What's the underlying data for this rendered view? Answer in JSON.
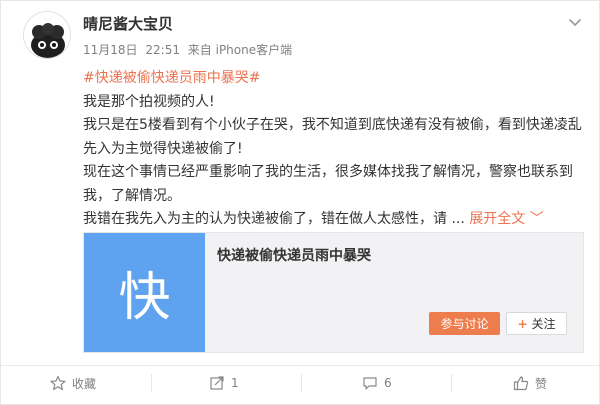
{
  "user": {
    "name": "晴尼酱大宝贝"
  },
  "meta": {
    "date": "11月18日",
    "time": "22:51",
    "source": "来自 iPhone客户端"
  },
  "content": {
    "hashtag": "#快递被偷快递员雨中暴哭#",
    "lines": [
      "我是那个拍视频的人!",
      "我只是在5楼看到有个小伙子在哭，我不知道到底快递有没有被偷，看到快递凌乱先入为主觉得快递被偷了!",
      "现在这个事情已经严重影响了我的生活，很多媒体找我了解情况，警察也联系到我，了解情况。",
      "我错在我先入为主的认为快递被偷了，错在做人太感性，请 ..."
    ],
    "expand_label": "展开全文",
    "expand_arrow": "﹀"
  },
  "card": {
    "thumb_char": "快",
    "thumb_color": "#5fa2f0",
    "title": "快递被偷快递员雨中暴哭",
    "discuss_label": "参与讨论",
    "follow_plus": "+",
    "follow_label": "关注"
  },
  "actions": {
    "collect_label": "收藏",
    "share_count": "1",
    "comment_count": "6",
    "like_label": "赞"
  },
  "colors": {
    "accent": "#eb7350",
    "discuss_button": "#ee7d4d",
    "text": "#333333",
    "meta": "#808080"
  }
}
